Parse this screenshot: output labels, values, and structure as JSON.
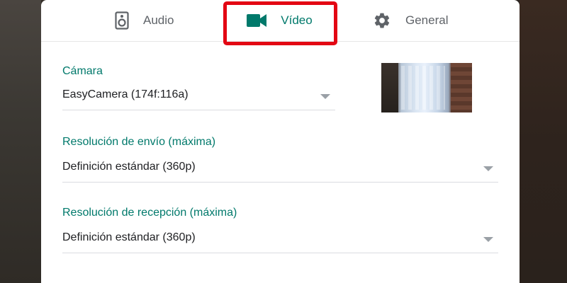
{
  "tabs": [
    {
      "label": "Audio",
      "icon": "speaker-icon"
    },
    {
      "label": "Vídeo",
      "icon": "video-camera-icon"
    },
    {
      "label": "General",
      "icon": "gear-icon"
    }
  ],
  "active_tab": "Vídeo",
  "camera": {
    "label": "Cámara",
    "value": "EasyCamera (174f:116a)"
  },
  "send_resolution": {
    "label": "Resolución de envío (máxima)",
    "value": "Definición estándar (360p)"
  },
  "receive_resolution": {
    "label": "Resolución de recepción (máxima)",
    "value": "Definición estándar (360p)"
  },
  "colors": {
    "accent": "#00796b",
    "highlight": "#e30613",
    "text": "#202124",
    "muted": "#5f6368"
  }
}
